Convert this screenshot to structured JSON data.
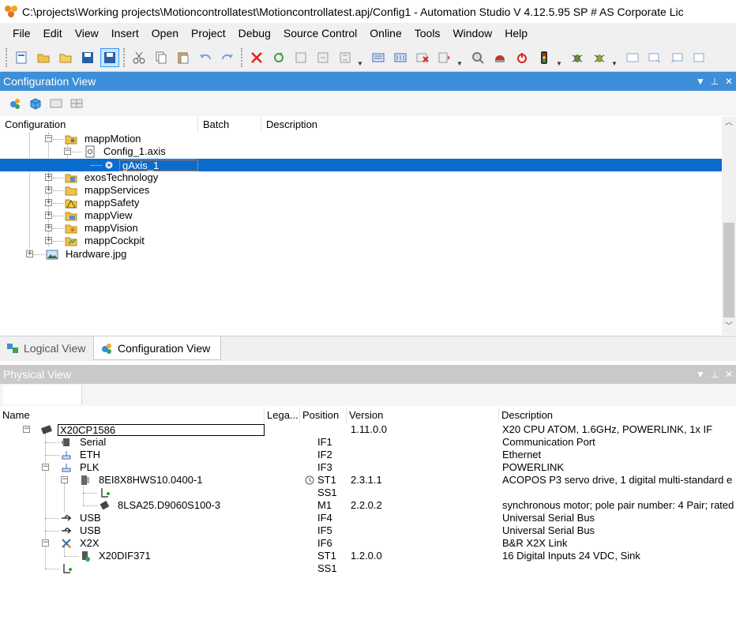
{
  "window": {
    "title": "C:\\projects\\Working projects\\Motioncontrollatest\\Motioncontrollatest.apj/Config1 - Automation Studio V 4.12.5.95 SP # AS Corporate Lic"
  },
  "menu": [
    {
      "label": "File"
    },
    {
      "label": "Edit"
    },
    {
      "label": "View"
    },
    {
      "label": "Insert"
    },
    {
      "label": "Open"
    },
    {
      "label": "Project"
    },
    {
      "label": "Debug"
    },
    {
      "label": "Source Control"
    },
    {
      "label": "Online"
    },
    {
      "label": "Tools"
    },
    {
      "label": "Window"
    },
    {
      "label": "Help"
    }
  ],
  "config_view": {
    "title": "Configuration View",
    "columns": [
      "Configuration",
      "Batch",
      "Description"
    ],
    "tree": [
      {
        "label": "mappMotion",
        "icon": "folder-motion-icon",
        "expander": "minus"
      },
      {
        "label": "Config_1.axis",
        "icon": "axis-file-icon",
        "expander": "minus"
      },
      {
        "label": "gAxis_1",
        "icon": "axis-gear-icon",
        "expander": "",
        "selected": true,
        "editing": true
      },
      {
        "label": "exosTechnology",
        "icon": "folder-exos-icon",
        "expander": "plus"
      },
      {
        "label": "mappServices",
        "icon": "folder-services-icon",
        "expander": "plus"
      },
      {
        "label": "mappSafety",
        "icon": "folder-safety-icon",
        "expander": "plus"
      },
      {
        "label": "mappView",
        "icon": "folder-view-icon",
        "expander": "plus"
      },
      {
        "label": "mappVision",
        "icon": "folder-vision-icon",
        "expander": "plus"
      },
      {
        "label": "mappCockpit",
        "icon": "folder-cockpit-icon",
        "expander": "plus"
      },
      {
        "label": "Hardware.jpg",
        "icon": "image-file-icon",
        "expander": "plus"
      }
    ]
  },
  "tabs": [
    {
      "label": "Logical View",
      "icon": "logical-view-icon",
      "active": false
    },
    {
      "label": "Configuration View",
      "icon": "configuration-view-icon",
      "active": true
    }
  ],
  "physical_view": {
    "title": "Physical View",
    "columns": [
      "Name",
      "Lega...",
      "Position",
      "Version",
      "Description"
    ],
    "rows": [
      {
        "name": "X20CP1586",
        "position": "",
        "version": "1.11.0.0",
        "description": "X20 CPU ATOM, 1.6GHz, POWERLINK, 1x IF",
        "icon": "cpu-icon",
        "expander": "minus"
      },
      {
        "name": "Serial",
        "position": "IF1",
        "version": "",
        "description": "Communication Port",
        "icon": "serial-port-icon",
        "expander": ""
      },
      {
        "name": "ETH",
        "position": "IF2",
        "version": "",
        "description": "Ethernet",
        "icon": "ethernet-icon",
        "expander": ""
      },
      {
        "name": "PLK",
        "position": "IF3",
        "version": "",
        "description": "POWERLINK",
        "icon": "powerlink-icon",
        "expander": "minus"
      },
      {
        "name": "8EI8X8HWS10.0400-1",
        "position": "ST1",
        "version": "2.3.1.1",
        "description": "ACOPOS P3 servo drive, 1 digital multi-standard e",
        "icon": "servo-drive-icon",
        "expander": "minus",
        "legacy_icon": "clock-icon"
      },
      {
        "name": "",
        "position": "SS1",
        "version": "",
        "description": "",
        "icon": "empty-slot-icon",
        "expander": ""
      },
      {
        "name": "8LSA25.D9060S100-3",
        "position": "M1",
        "version": "2.2.0.2",
        "description": "synchronous motor; pole pair number: 4 Pair; rated",
        "icon": "motor-icon",
        "expander": ""
      },
      {
        "name": "USB",
        "position": "IF4",
        "version": "",
        "description": "Universal Serial Bus",
        "icon": "usb-icon",
        "expander": ""
      },
      {
        "name": "USB",
        "position": "IF5",
        "version": "",
        "description": "Universal Serial Bus",
        "icon": "usb-icon",
        "expander": ""
      },
      {
        "name": "X2X",
        "position": "IF6",
        "version": "",
        "description": "B&R X2X Link",
        "icon": "x2x-icon",
        "expander": "minus"
      },
      {
        "name": "X20DIF371",
        "position": "ST1",
        "version": "1.2.0.0",
        "description": "16 Digital Inputs 24 VDC, Sink",
        "icon": "io-module-icon",
        "expander": ""
      },
      {
        "name": "",
        "position": "SS1",
        "version": "",
        "description": "",
        "icon": "empty-slot-icon",
        "expander": ""
      }
    ]
  },
  "colors": {
    "active_header": "#3c8fd8",
    "inactive_header": "#c9c9c9",
    "selection": "#0a6ccf"
  }
}
